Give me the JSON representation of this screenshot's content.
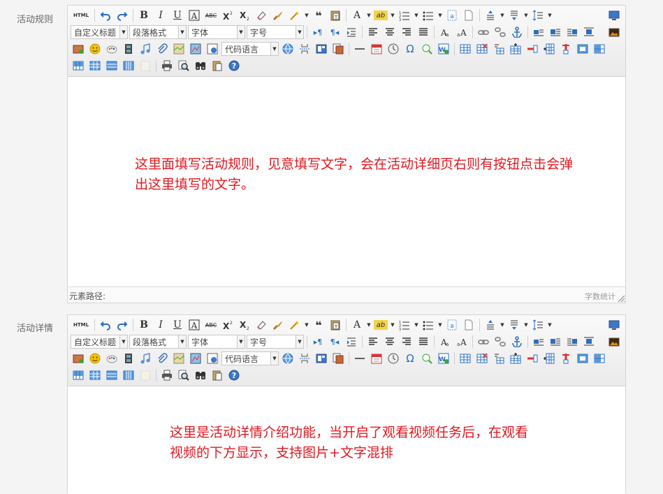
{
  "editors": [
    {
      "label": "活动规则",
      "content_lines": [
        "这里面填写活动规则，见意填写文字，会在活动详细页右则有按钮点击会弹",
        "出这里填写的文字。"
      ],
      "status_path": "元素路径:",
      "status_count": "字数统计"
    },
    {
      "label": "活动详情",
      "content_lines": [
        "这里是活动详情介绍功能，当开启了观看视频任务后，在观看",
        "视频的下方显示，支持图片+文字混排"
      ],
      "status_path": "",
      "status_count": ""
    }
  ],
  "toolbar": {
    "html_label": "HTML",
    "bold_label": "B",
    "italic_label": "I",
    "underline_label": "U",
    "strike_label": "ABC",
    "quote_label": "❝",
    "font_color_label": "A",
    "highlight_label": "ab",
    "omega_label": "Ω",
    "selects": {
      "custom_title": "自定义标题",
      "paragraph": "段落格式",
      "font_family": "字体",
      "font_size": "字号",
      "code_lang": "代码语言"
    }
  },
  "colors": {
    "content_text": "#e3171f",
    "label": "#666666"
  }
}
